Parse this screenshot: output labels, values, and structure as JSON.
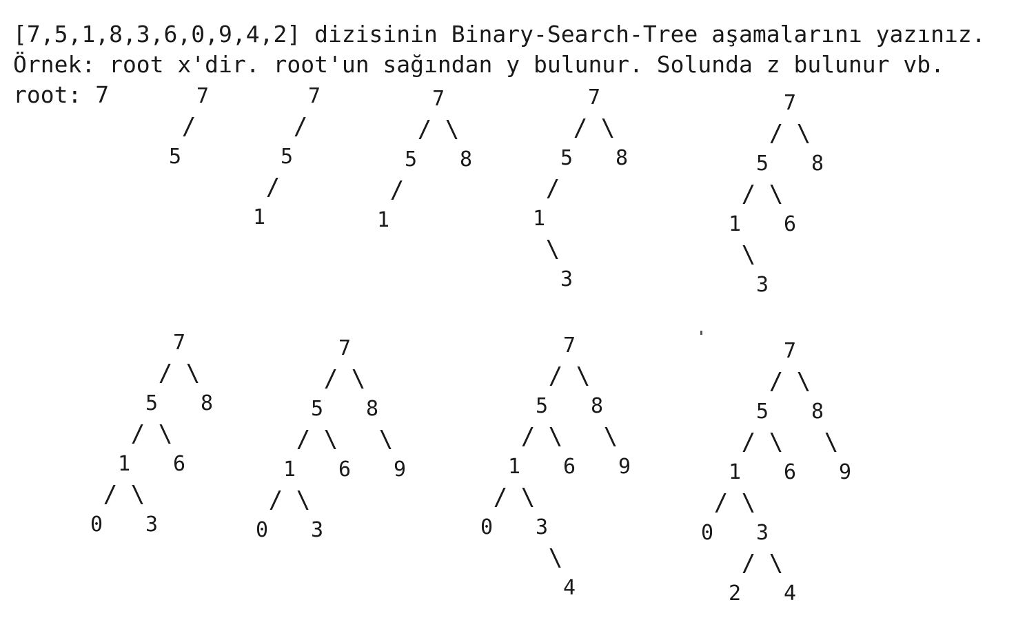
{
  "document": {
    "line1": "[7,5,1,8,3,6,0,9,4,2] dizisinin Binary-Search-Tree aşamalarını yazınız.",
    "line2": "Örnek: root x'dir. root'un sağından y bulunur. Solunda z bulunur vb.",
    "line3": "root: 7"
  },
  "trees": [
    {
      "nodes": [
        "7",
        "5"
      ],
      "edges": [
        "/"
      ]
    },
    {
      "nodes": [
        "7",
        "5",
        "1"
      ],
      "edges": [
        "/",
        "/"
      ]
    },
    {
      "nodes": [
        "7",
        "5",
        "8",
        "1"
      ],
      "edges": [
        "/",
        "\\",
        "/"
      ]
    },
    {
      "nodes": [
        "7",
        "5",
        "8",
        "1",
        "3"
      ],
      "edges": [
        "/",
        "\\",
        "/",
        "\\"
      ]
    },
    {
      "nodes": [
        "7",
        "5",
        "8",
        "1",
        "6",
        "3"
      ],
      "edges": [
        "/",
        "\\",
        "/",
        "\\",
        "\\"
      ]
    },
    {
      "nodes": [
        "7",
        "5",
        "8",
        "1",
        "6",
        "0",
        "3"
      ],
      "edges": [
        "/",
        "\\",
        "/",
        "\\",
        "/",
        "\\"
      ]
    },
    {
      "nodes": [
        "7",
        "5",
        "8",
        "1",
        "6",
        "9",
        "0",
        "3"
      ],
      "edges": [
        "/",
        "\\",
        "/",
        "\\",
        "\\",
        "/",
        "\\"
      ]
    },
    {
      "nodes": [
        "7",
        "5",
        "8",
        "1",
        "6",
        "9",
        "0",
        "3",
        "4"
      ],
      "edges": [
        "/",
        "\\",
        "/",
        "\\",
        "\\",
        "/",
        "\\",
        "\\"
      ]
    },
    {
      "nodes": [
        "7",
        "5",
        "8",
        "1",
        "6",
        "9",
        "0",
        "3",
        "2",
        "4"
      ],
      "edges": [
        "/",
        "\\",
        "/",
        "\\",
        "\\",
        "/",
        "\\",
        "/",
        "\\"
      ]
    }
  ]
}
